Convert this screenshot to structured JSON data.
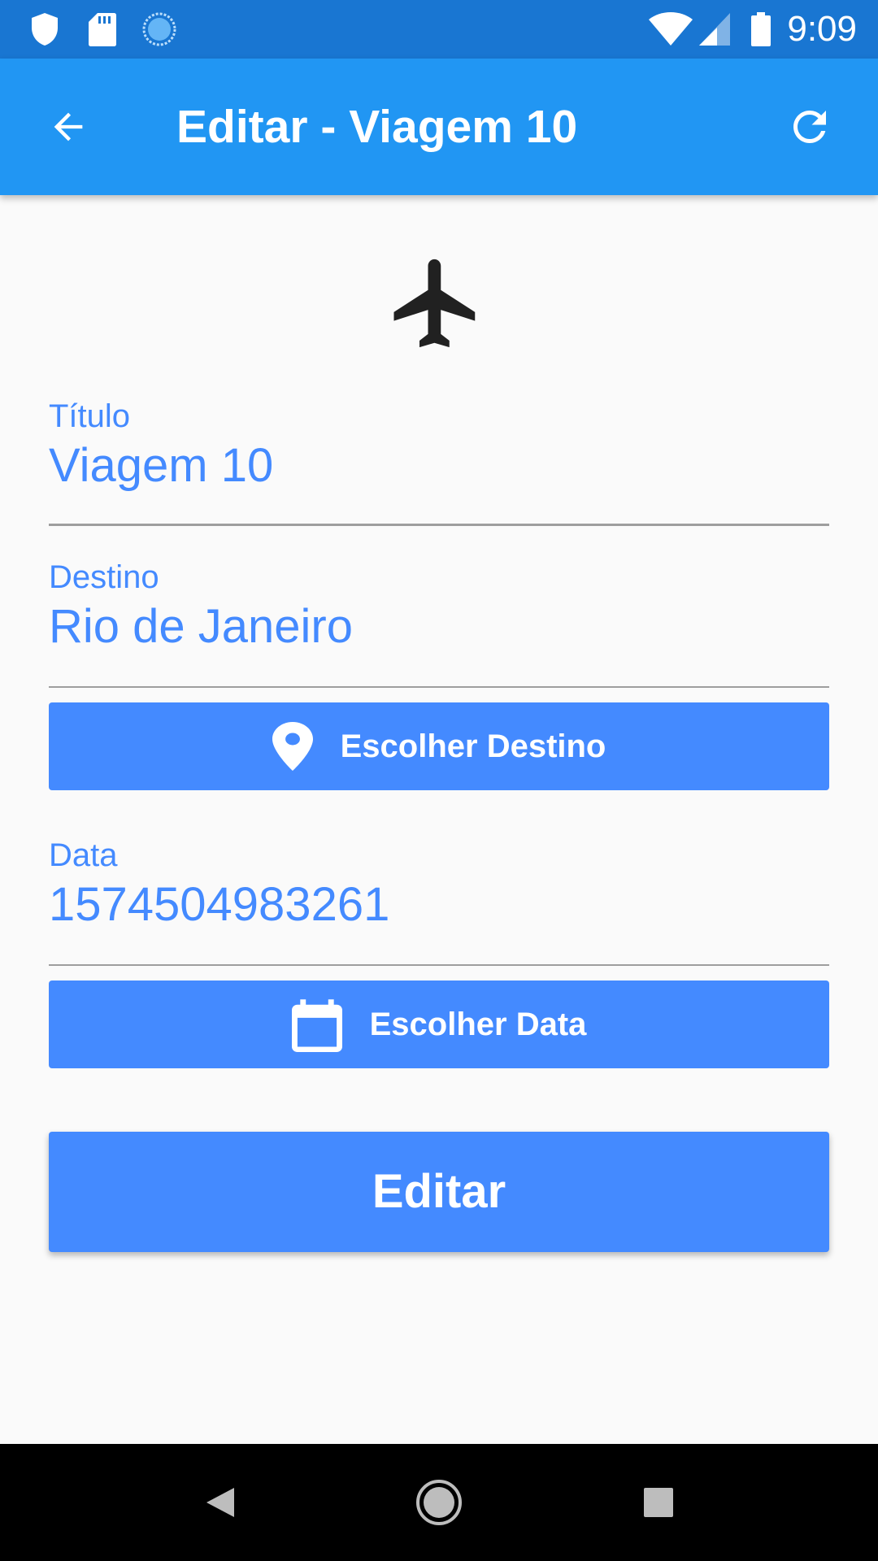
{
  "status_bar": {
    "time": "9:09",
    "left_icons": [
      "shield-icon",
      "sd-card-icon",
      "sync-circle-icon"
    ],
    "right_icons": [
      "wifi-icon",
      "cell-signal-icon",
      "battery-icon"
    ]
  },
  "app_bar": {
    "title": "Editar - Viagem 10",
    "back_icon": "arrow-back-icon",
    "refresh_icon": "refresh-icon",
    "color": "#2196f3"
  },
  "header_icon": "airplane-icon",
  "form": {
    "titulo": {
      "label": "Título",
      "value": "Viagem 10"
    },
    "destino": {
      "label": "Destino",
      "value": "Rio de Janeiro"
    },
    "escolher_destino_button": {
      "label": "Escolher Destino",
      "icon": "location-pin-icon"
    },
    "data": {
      "label": "Data",
      "value": "1574504983261"
    },
    "escolher_data_button": {
      "label": "Escolher Data",
      "icon": "calendar-icon"
    },
    "submit_button": {
      "label": "Editar"
    },
    "accent_color": "#448aff"
  },
  "nav_bar": {
    "icons": [
      "nav-back-icon",
      "nav-home-icon",
      "nav-recents-icon"
    ]
  }
}
